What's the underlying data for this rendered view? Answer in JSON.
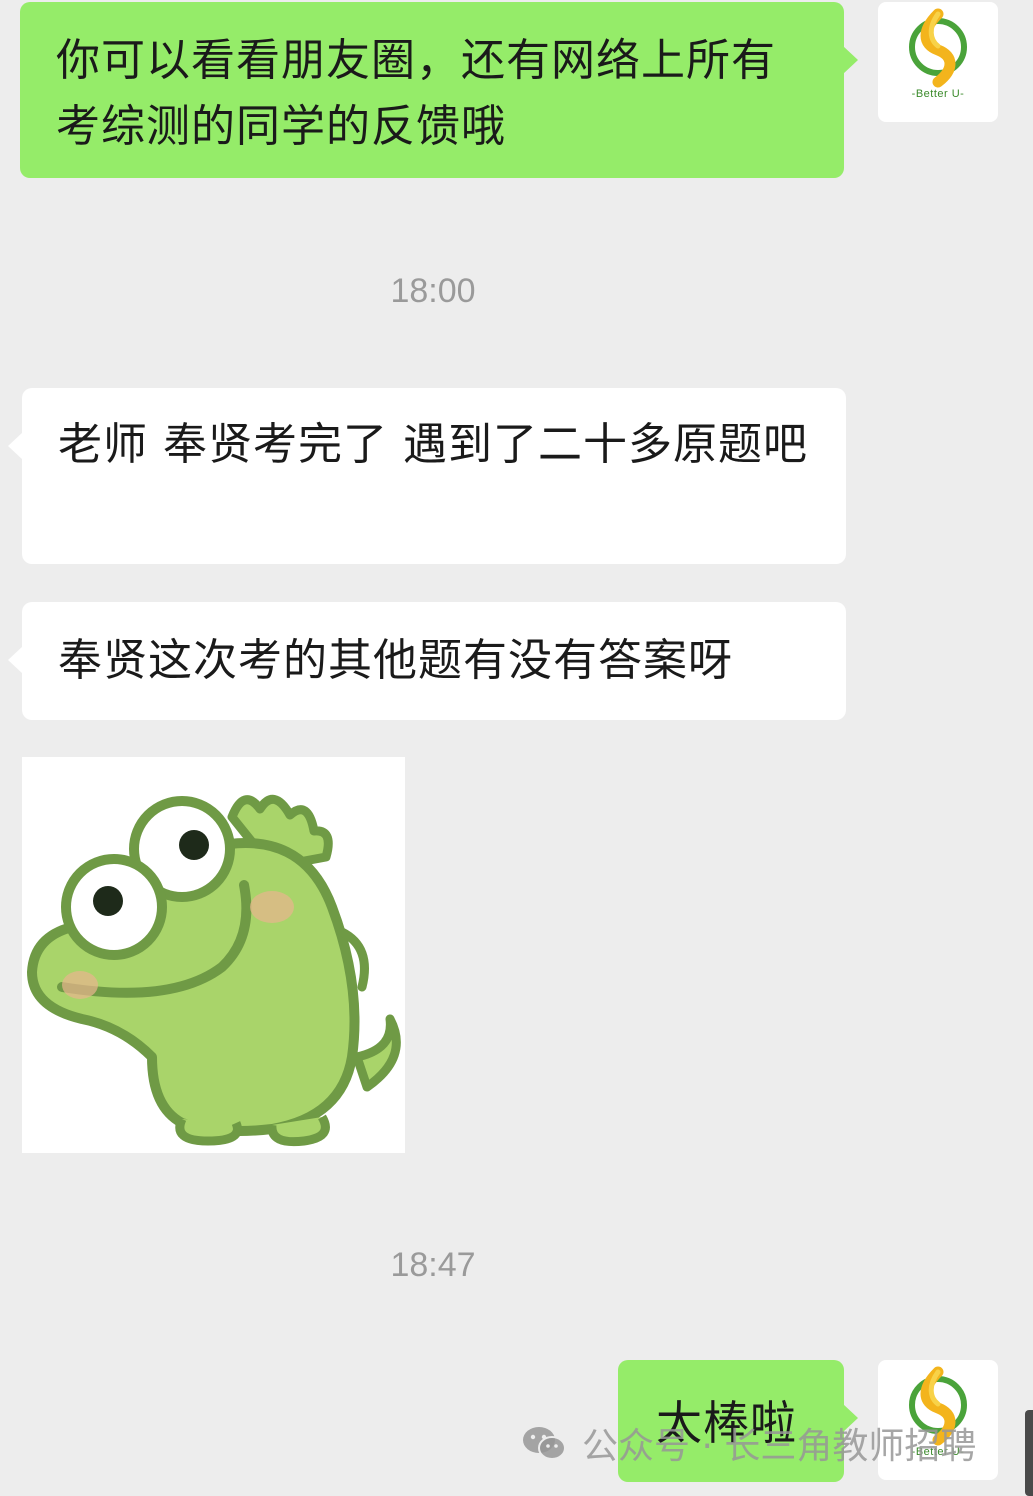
{
  "messages": [
    {
      "text": "你可以看看朋友圈，还有网络上所有考综测的同学的反馈哦"
    },
    {
      "text": "老师 奉贤考完了 遇到了二十多原题吧"
    },
    {
      "text": "奉贤这次考的其他题有没有答案呀"
    },
    {
      "text": "太棒啦"
    }
  ],
  "timestamps": [
    "18:00",
    "18:47"
  ],
  "avatar": {
    "brand_text": "-Better U-"
  },
  "sticker": {
    "icon": "green-dinosaur-sticker"
  },
  "watermark": {
    "text": "公众号 · 长三角教师招聘",
    "icon": "wechat-official-account-icon"
  },
  "colors": {
    "background": "#ededed",
    "outgoing_bubble": "#95ec69",
    "incoming_bubble": "#ffffff",
    "sticker_green": "#a9d46a",
    "sticker_outline": "#6f9a45"
  }
}
